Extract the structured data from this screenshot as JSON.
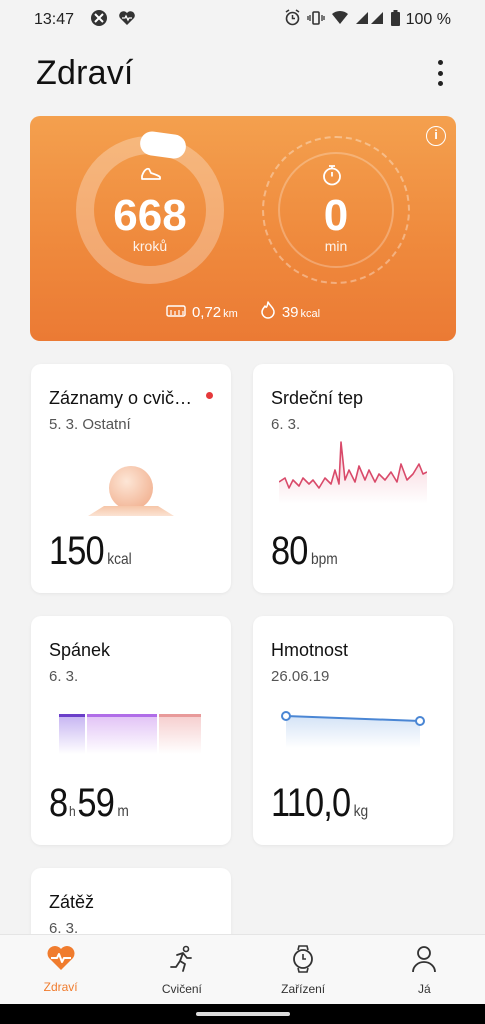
{
  "status_bar": {
    "time": "13:47",
    "battery": "100 %"
  },
  "header": {
    "title": "Zdraví"
  },
  "hero": {
    "steps_value": "668",
    "steps_unit": "kroků",
    "minutes_value": "0",
    "minutes_unit": "min",
    "distance_value": "0,72",
    "distance_unit": "km",
    "calories_value": "39",
    "calories_unit": "kcal"
  },
  "cards": {
    "exercise": {
      "title": "Záznamy o cvič…",
      "sub": "5. 3. Ostatní",
      "value": "150",
      "unit": "kcal"
    },
    "heart": {
      "title": "Srdeční tep",
      "sub": "6. 3.",
      "value": "80",
      "unit": "bpm"
    },
    "sleep": {
      "title": "Spánek",
      "sub": "6. 3.",
      "hours": "8",
      "hours_unit": "h",
      "minutes": "59",
      "minutes_unit": "m"
    },
    "weight": {
      "title": "Hmotnost",
      "sub": "26.06.19",
      "value": "110,0",
      "unit": "kg"
    },
    "stress": {
      "title": "Zátěž",
      "sub": "6. 3."
    }
  },
  "nav": {
    "health": "Zdraví",
    "exercise": "Cvičení",
    "devices": "Zařízení",
    "me": "Já"
  },
  "colors": {
    "accent": "#f07c2e",
    "hero_top": "#f4a04e",
    "hero_bottom": "#eb7a34",
    "heart_line": "#d94a6a",
    "sleep_deep": "#6b3fc9",
    "sleep_light": "#b06de8",
    "sleep_rem": "#e89a9a",
    "weight_line": "#4a86d4"
  }
}
